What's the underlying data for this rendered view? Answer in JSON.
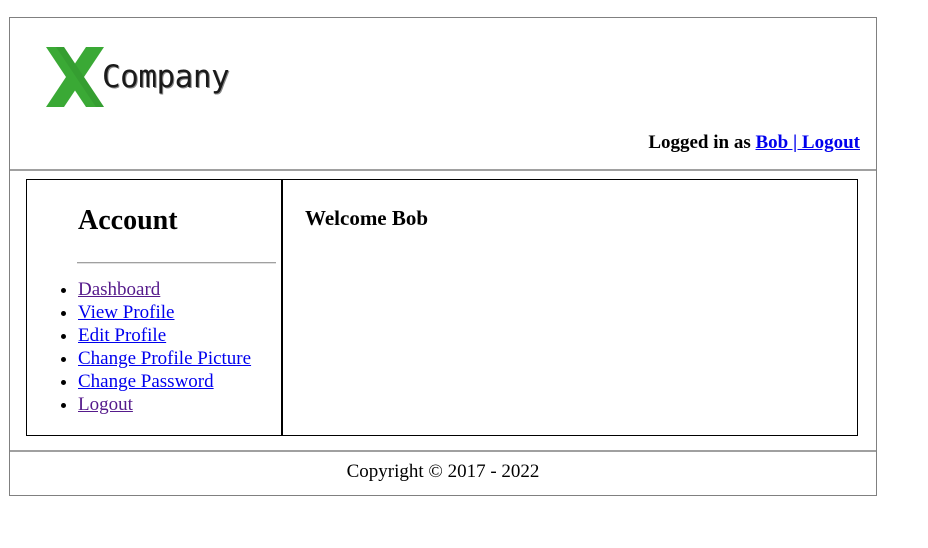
{
  "header": {
    "logo_text": "Company",
    "logo_mark_color": "#3aa935",
    "login_prefix": "Logged in as",
    "user_link": "Bob | Logout"
  },
  "sidebar": {
    "title": "Account",
    "items": [
      {
        "label": "Dashboard",
        "visited": true
      },
      {
        "label": "View Profile",
        "visited": false
      },
      {
        "label": "Edit Profile",
        "visited": false
      },
      {
        "label": "Change Profile Picture ",
        "visited": false
      },
      {
        "label": "Change Password",
        "visited": false
      },
      {
        "label": "Logout",
        "visited": true
      }
    ]
  },
  "main": {
    "welcome": "Welcome Bob"
  },
  "footer": {
    "copyright": "Copyright © 2017 - 2022"
  },
  "colors": {
    "link": "#0000ee",
    "visited_link": "#551a8b",
    "border": "#808080"
  }
}
